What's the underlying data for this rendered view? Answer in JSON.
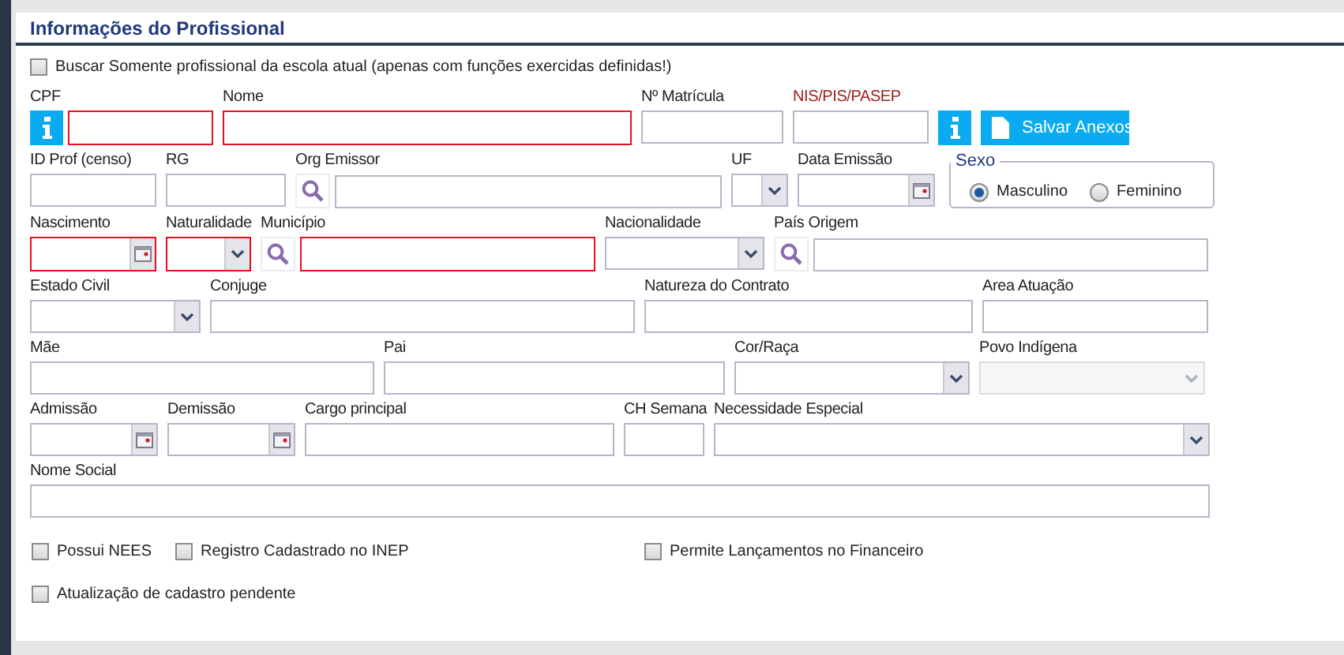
{
  "title": "Informações do Profissional",
  "filter_checkbox": {
    "label": "Buscar Somente profissional da escola atual (apenas com funções exercidas definidas!)",
    "checked": false
  },
  "rows": [
    [
      {
        "kind": "info-text",
        "label": "CPF",
        "required": true,
        "emphasis": false,
        "disabled": false
      },
      {
        "kind": "text",
        "label": "Nome",
        "required": true,
        "emphasis": false,
        "disabled": false
      },
      {
        "kind": "text",
        "label": "Nº Matrícula",
        "required": false,
        "emphasis": false,
        "disabled": false
      },
      {
        "kind": "text",
        "label": "NIS/PIS/PASEP",
        "required": false,
        "emphasis": true,
        "disabled": false
      },
      {
        "kind": "info-button"
      },
      {
        "kind": "button",
        "label": "Salvar Anexos"
      }
    ],
    [
      {
        "kind": "text",
        "label": "ID Prof (censo)",
        "required": false,
        "emphasis": false,
        "disabled": false
      },
      {
        "kind": "text",
        "label": "RG",
        "required": false,
        "emphasis": false,
        "disabled": false
      },
      {
        "kind": "search",
        "label": "Org Emissor",
        "required": false,
        "emphasis": false,
        "disabled": false
      },
      {
        "kind": "select",
        "label": "UF",
        "required": false,
        "emphasis": false,
        "disabled": false
      },
      {
        "kind": "date",
        "label": "Data Emissão",
        "required": false,
        "emphasis": false,
        "disabled": false
      },
      {
        "kind": "radio-group",
        "legend": "Sexo",
        "options": [
          {
            "label": "Masculino",
            "selected": true
          },
          {
            "label": "Feminino",
            "selected": false
          }
        ]
      }
    ],
    [
      {
        "kind": "date",
        "label": "Nascimento",
        "required": true,
        "emphasis": false,
        "disabled": false
      },
      {
        "kind": "select",
        "label": "Naturalidade",
        "required": true,
        "emphasis": false,
        "disabled": false
      },
      {
        "kind": "search",
        "label": "Município",
        "required": true,
        "emphasis": false,
        "disabled": false
      },
      {
        "kind": "select",
        "label": "Nacionalidade",
        "required": false,
        "emphasis": false,
        "disabled": false
      },
      {
        "kind": "search",
        "label": "País Origem",
        "required": false,
        "emphasis": false,
        "disabled": false
      }
    ],
    [
      {
        "kind": "select",
        "label": "Estado Civil",
        "required": false,
        "emphasis": false,
        "disabled": false
      },
      {
        "kind": "text",
        "label": "Conjuge",
        "required": false,
        "emphasis": false,
        "disabled": false
      },
      {
        "kind": "text",
        "label": "Natureza do Contrato",
        "required": false,
        "emphasis": false,
        "disabled": false
      },
      {
        "kind": "text",
        "label": "Area Atuação",
        "required": false,
        "emphasis": false,
        "disabled": false
      }
    ],
    [
      {
        "kind": "text",
        "label": "Mãe",
        "required": false,
        "emphasis": false,
        "disabled": false
      },
      {
        "kind": "text",
        "label": "Pai",
        "required": false,
        "emphasis": false,
        "disabled": false
      },
      {
        "kind": "select",
        "label": "Cor/Raça",
        "required": false,
        "emphasis": false,
        "disabled": false
      },
      {
        "kind": "select",
        "label": "Povo Indígena",
        "required": false,
        "emphasis": false,
        "disabled": true
      }
    ],
    [
      {
        "kind": "date",
        "label": "Admissão",
        "required": false,
        "emphasis": false,
        "disabled": false
      },
      {
        "kind": "date",
        "label": "Demissão",
        "required": false,
        "emphasis": false,
        "disabled": false
      },
      {
        "kind": "text",
        "label": "Cargo principal",
        "required": false,
        "emphasis": false,
        "disabled": false
      },
      {
        "kind": "text",
        "label": "CH Semana",
        "required": false,
        "emphasis": false,
        "disabled": false
      },
      {
        "kind": "select",
        "label": "Necessidade Especial",
        "required": false,
        "emphasis": false,
        "disabled": false
      }
    ],
    [
      {
        "kind": "text",
        "label": "Nome Social",
        "required": false,
        "emphasis": false,
        "disabled": false
      }
    ]
  ],
  "option_rows": [
    [
      {
        "label": "Possui NEES",
        "checked": false
      },
      {
        "label": "Registro Cadastrado no INEP",
        "checked": false
      },
      {
        "label": "Permite Lançamentos no Financeiro",
        "checked": false
      }
    ],
    [
      {
        "label": "Atualização de cadastro pendente",
        "checked": false
      }
    ]
  ]
}
